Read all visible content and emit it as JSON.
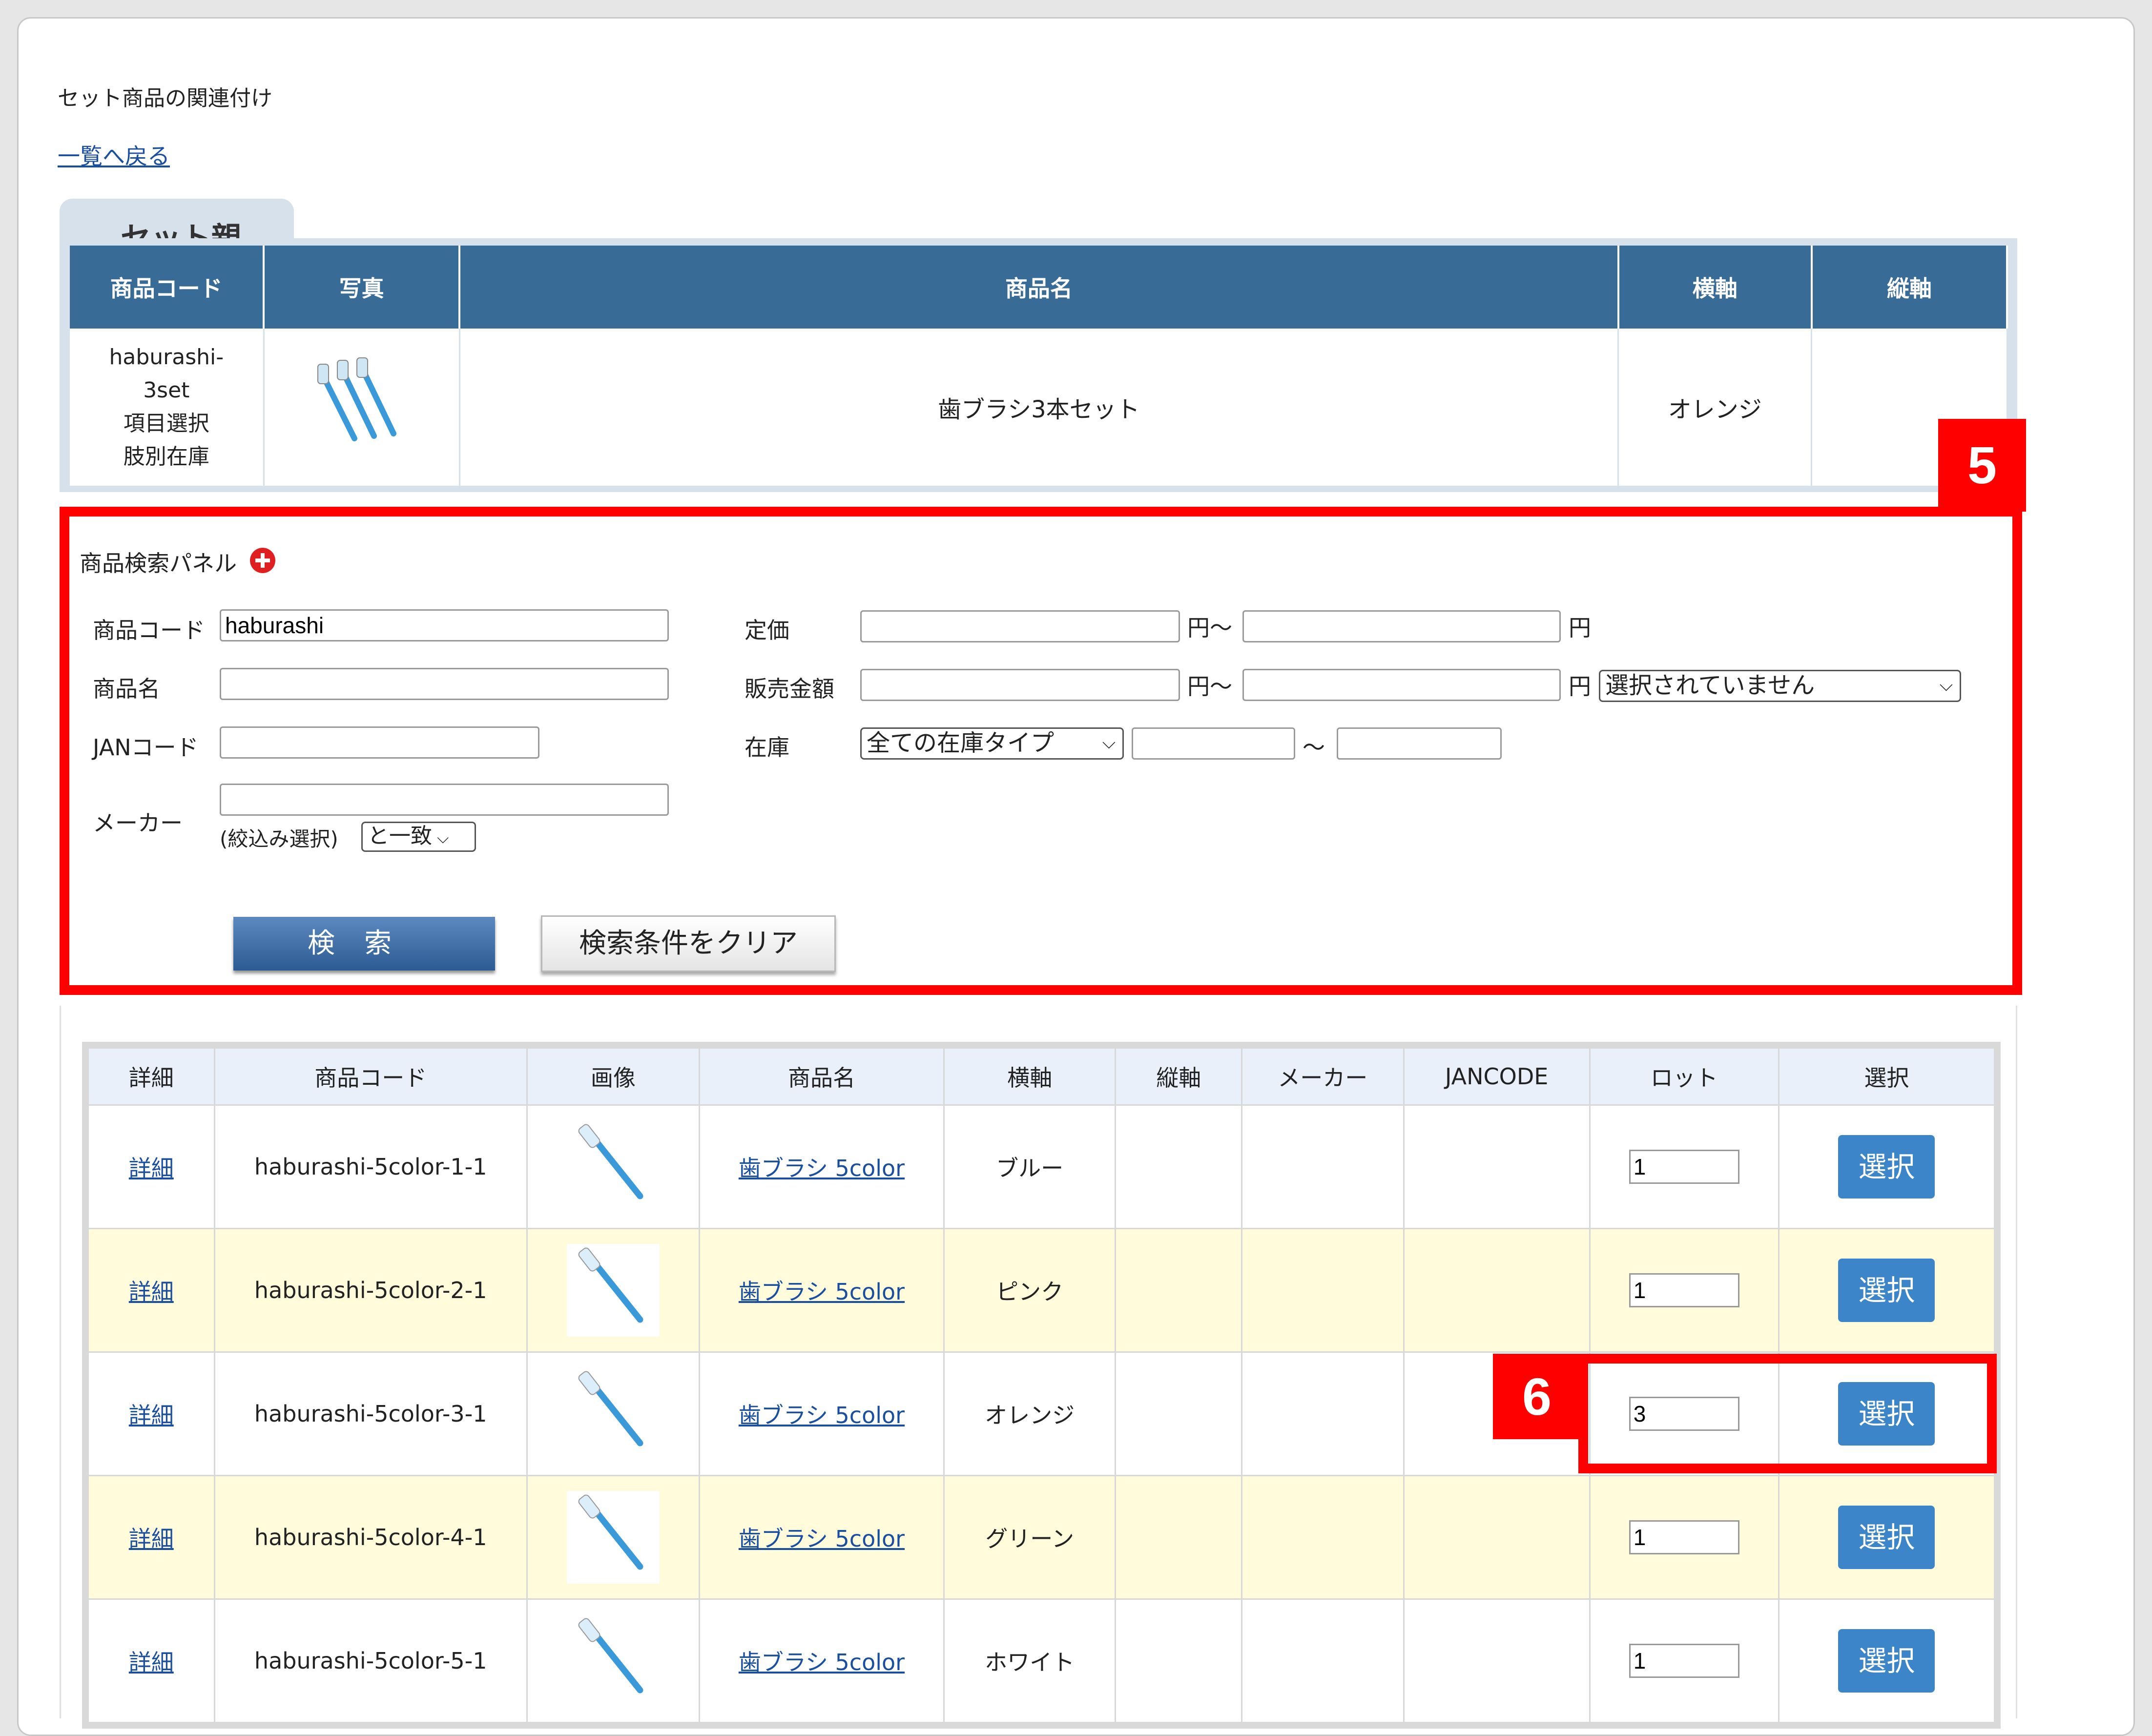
{
  "page": {
    "title": "セット商品の関連付け",
    "back_link": "一覧へ戻る"
  },
  "parent": {
    "tab_label": "セット親",
    "headers": [
      "商品コード",
      "写真",
      "商品名",
      "横軸",
      "縦軸"
    ],
    "code_lines": [
      "haburashi-",
      "3set",
      "項目選択",
      "肢別在庫"
    ],
    "name": "歯ブラシ3本セット",
    "horizontal": "オレンジ",
    "vertical": ""
  },
  "annotations": {
    "badge5": "5",
    "badge6": "6"
  },
  "search_panel": {
    "title": "商品検索パネル",
    "product_code_label": "商品コード",
    "product_code_value": "haburashi",
    "product_name_label": "商品名",
    "jan_label": "JANコード",
    "maker_label": "メーカー",
    "filter_label": "(絞込み選択)",
    "match_option": "と一致",
    "list_price_label": "定価",
    "sale_price_label": "販売金額",
    "stock_label": "在庫",
    "yen_tilde": "円～",
    "yen": "円",
    "tilde": "～",
    "sale_select": "選択されていません",
    "stock_type_select": "全ての在庫タイプ",
    "search_button": "検索",
    "clear_button": "検索条件をクリア"
  },
  "results": {
    "headers": [
      "詳細",
      "商品コード",
      "画像",
      "商品名",
      "横軸",
      "縦軸",
      "メーカー",
      "JANCODE",
      "ロット",
      "選択"
    ],
    "rows": [
      {
        "detail": "詳細",
        "code": "haburashi-5color-1-1",
        "name": "歯ブラシ 5color",
        "horizontal": "ブルー",
        "vertical": "",
        "maker": "",
        "jancode": "",
        "lot": "1",
        "select": "選択"
      },
      {
        "detail": "詳細",
        "code": "haburashi-5color-2-1",
        "name": "歯ブラシ 5color",
        "horizontal": "ピンク",
        "vertical": "",
        "maker": "",
        "jancode": "",
        "lot": "1",
        "select": "選択"
      },
      {
        "detail": "詳細",
        "code": "haburashi-5color-3-1",
        "name": "歯ブラシ 5color",
        "horizontal": "オレンジ",
        "vertical": "",
        "maker": "",
        "jancode": "",
        "lot": "3",
        "select": "選択"
      },
      {
        "detail": "詳細",
        "code": "haburashi-5color-4-1",
        "name": "歯ブラシ 5color",
        "horizontal": "グリーン",
        "vertical": "",
        "maker": "",
        "jancode": "",
        "lot": "1",
        "select": "選択"
      },
      {
        "detail": "詳細",
        "code": "haburashi-5color-5-1",
        "name": "歯ブラシ 5color",
        "horizontal": "ホワイト",
        "vertical": "",
        "maker": "",
        "jancode": "",
        "lot": "1",
        "select": "選択"
      }
    ]
  },
  "colors": {
    "accent": "#386b95",
    "highlight": "#ff0000",
    "select_button": "#3c85c8",
    "alt_row": "#fffbdb"
  },
  "icons": {
    "add": "plus-circle-icon",
    "product_image": "toothbrush-icon"
  }
}
